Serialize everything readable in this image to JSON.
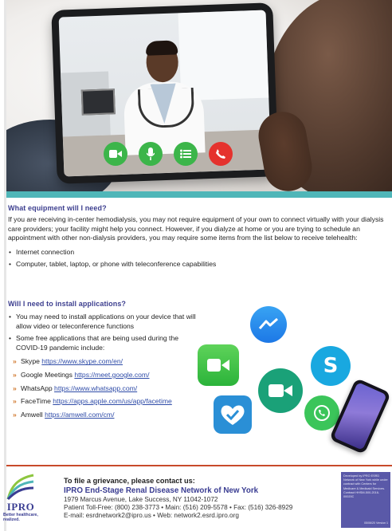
{
  "section1": {
    "heading": "What equipment will I need?",
    "intro": "If you are receiving in-center hemodialysis, you may not require equipment of your own to connect virtually with your dialysis care providers; your facility might help you connect. However, if you dialyze at home or you are trying to schedule an appointment with other non-dialysis providers, you may require some items from the list below to receive telehealth:",
    "items": [
      "Internet connection",
      "Computer, tablet, laptop, or phone with teleconference capabilities"
    ]
  },
  "section2": {
    "heading": "Will I need to install applications?",
    "items": [
      "You may need to install applications on your device that will allow video or teleconference functions",
      "Some free applications that are being used during the COVID-19 pandemic include:"
    ],
    "apps": [
      {
        "name": "Skype",
        "url": "https://www.skype.com/en/"
      },
      {
        "name": "Google Meetings",
        "url": "https://meet.google.com/"
      },
      {
        "name": "WhatsApp",
        "url": "https://www.whatsapp.com/"
      },
      {
        "name": "FaceTime",
        "url": "https://apps.apple.com/us/app/facetime"
      },
      {
        "name": "Amwell",
        "url": "https://amwell.com/cm/"
      }
    ]
  },
  "icons": {
    "hero_buttons": [
      "video-camera-icon",
      "microphone-icon",
      "list-icon",
      "phone-hangup-icon"
    ],
    "apps": [
      "facetime-icon",
      "messenger-icon",
      "google-meet-icon",
      "skype-icon",
      "whatsapp-icon",
      "amwell-icon"
    ],
    "skype_letter": "S"
  },
  "footer": {
    "logo_word": "IPRO",
    "logo_tagline": "Better healthcare, realized.",
    "grievance": "To file a grievance, please contact us:",
    "org": "IPRO End-Stage Renal Disease Network of New York",
    "address": "1979 Marcus Avenue, Lake Success, NY 11042-1072",
    "phones": "Patient Toll-Free: (800) 238-3773  •  Main: (516) 209-5578  •  Fax: (516) 326-8929",
    "email_web": "E-mail: esrdnetwork2@ipro.us  •  Web: network2.esrd.ipro.org",
    "developed": "Developed by IPRO ESRD Network of New York while under contract with Centers for Medicare & Medicaid Services. Contract HHSM-500-2016-00020C",
    "version": "05/06/20 Version 1"
  },
  "colors": {
    "heading": "#3d3f8f",
    "teal_bar": "#4fb6b8",
    "footer_rule": "#c84a2b",
    "link": "#2f4ca8",
    "call_green": "#3cb54a",
    "call_red": "#e5322d",
    "dev_box": "#5a59a8"
  }
}
